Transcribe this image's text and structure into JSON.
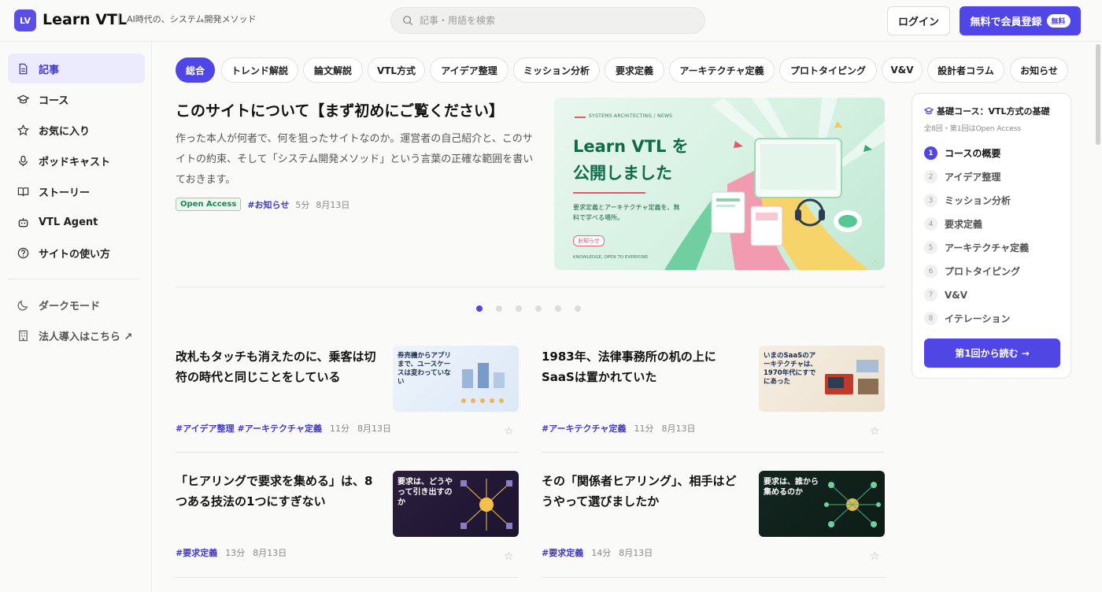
{
  "header": {
    "logo_badge": "LV",
    "logo_text": "Learn VTL",
    "tagline": "AI時代の、システム開発メソッド",
    "search_placeholder": "記事・用語を検索",
    "login_label": "ログイン",
    "signup_label": "無料で会員登録",
    "signup_badge": "無料"
  },
  "sidebar": {
    "items": [
      {
        "label": "記事",
        "icon": "document-icon"
      },
      {
        "label": "コース",
        "icon": "graduation-cap-icon"
      },
      {
        "label": "お気に入り",
        "icon": "star-icon"
      },
      {
        "label": "ポッドキャスト",
        "icon": "microphone-icon"
      },
      {
        "label": "ストーリー",
        "icon": "book-icon"
      },
      {
        "label": "VTL Agent",
        "icon": "robot-icon"
      },
      {
        "label": "サイトの使い方",
        "icon": "help-icon"
      }
    ],
    "dark_mode": "ダークモード",
    "enterprise": "法人導入はこちら ↗"
  },
  "tabs": [
    "総合",
    "トレンド解説",
    "論文解説",
    "VTL方式",
    "アイデア整理",
    "ミッション分析",
    "要求定義",
    "アーキテクチャ定義",
    "プロトタイピング",
    "V&V",
    "設計者コラム",
    "お知らせ"
  ],
  "hero": {
    "title": "このサイトについて【まず初めにご覧ください】",
    "description": "作った本人が何者で、何を狙ったサイトなのか。運営者の自己紹介と、このサイトの約束、そして「システム開発メソッド」という言葉の正確な範囲を書いておきます。",
    "badge": "Open Access",
    "tag": "#お知らせ",
    "read_time": "5分",
    "date": "8月13日",
    "image": {
      "kicker": "SYSTEMS ARCHITECTING / NEWS",
      "line1": "Learn VTL を",
      "line2": "公開しました",
      "sub": "要求定義とアーキテクチャ定義を、無料で学べる場所。",
      "pill": "お知らせ",
      "foot": "KNOWLEDGE, OPEN TO EVERYONE"
    },
    "carousel_count": 6,
    "carousel_active": 0
  },
  "course": {
    "title": "基礎コース：VTL方式の基礎",
    "subtitle": "全8回・第1回はOpen Access",
    "steps": [
      {
        "num": "1",
        "label": "コースの概要"
      },
      {
        "num": "2",
        "label": "アイデア整理"
      },
      {
        "num": "3",
        "label": "ミッション分析"
      },
      {
        "num": "4",
        "label": "要求定義"
      },
      {
        "num": "5",
        "label": "アーキテクチャ定義"
      },
      {
        "num": "6",
        "label": "プロトタイピング"
      },
      {
        "num": "7",
        "label": "V&V"
      },
      {
        "num": "8",
        "label": "イテレーション"
      }
    ],
    "button": "第1回から読む →"
  },
  "articles": [
    {
      "title": "改札もタッチも消えたのに、乗客は切符の時代と同じことをしている",
      "tags": "#アイデア整理 #アーキテクチャ定義",
      "read_time": "11分",
      "date": "8月13日",
      "thumb_text": "券売機からアプリまで、ユースケースは変わっていない"
    },
    {
      "title": "1983年、法律事務所の机の上にSaaSは置かれていた",
      "tags": "#アーキテクチャ定義",
      "read_time": "11分",
      "date": "8月13日",
      "thumb_text": "いまのSaaSのアーキテクチャは、1970年代にすでにあった"
    },
    {
      "title": "「ヒアリングで要求を集める」は、8つある技法の1つにすぎない",
      "tags": "#要求定義",
      "read_time": "13分",
      "date": "8月13日",
      "thumb_text": "要求は、どうやって引き出すのか"
    },
    {
      "title": "その「関係者ヒアリング」、相手はどうやって選びましたか",
      "tags": "#要求定義",
      "read_time": "14分",
      "date": "8月13日",
      "thumb_text": "要求は、誰から集めるのか"
    }
  ]
}
